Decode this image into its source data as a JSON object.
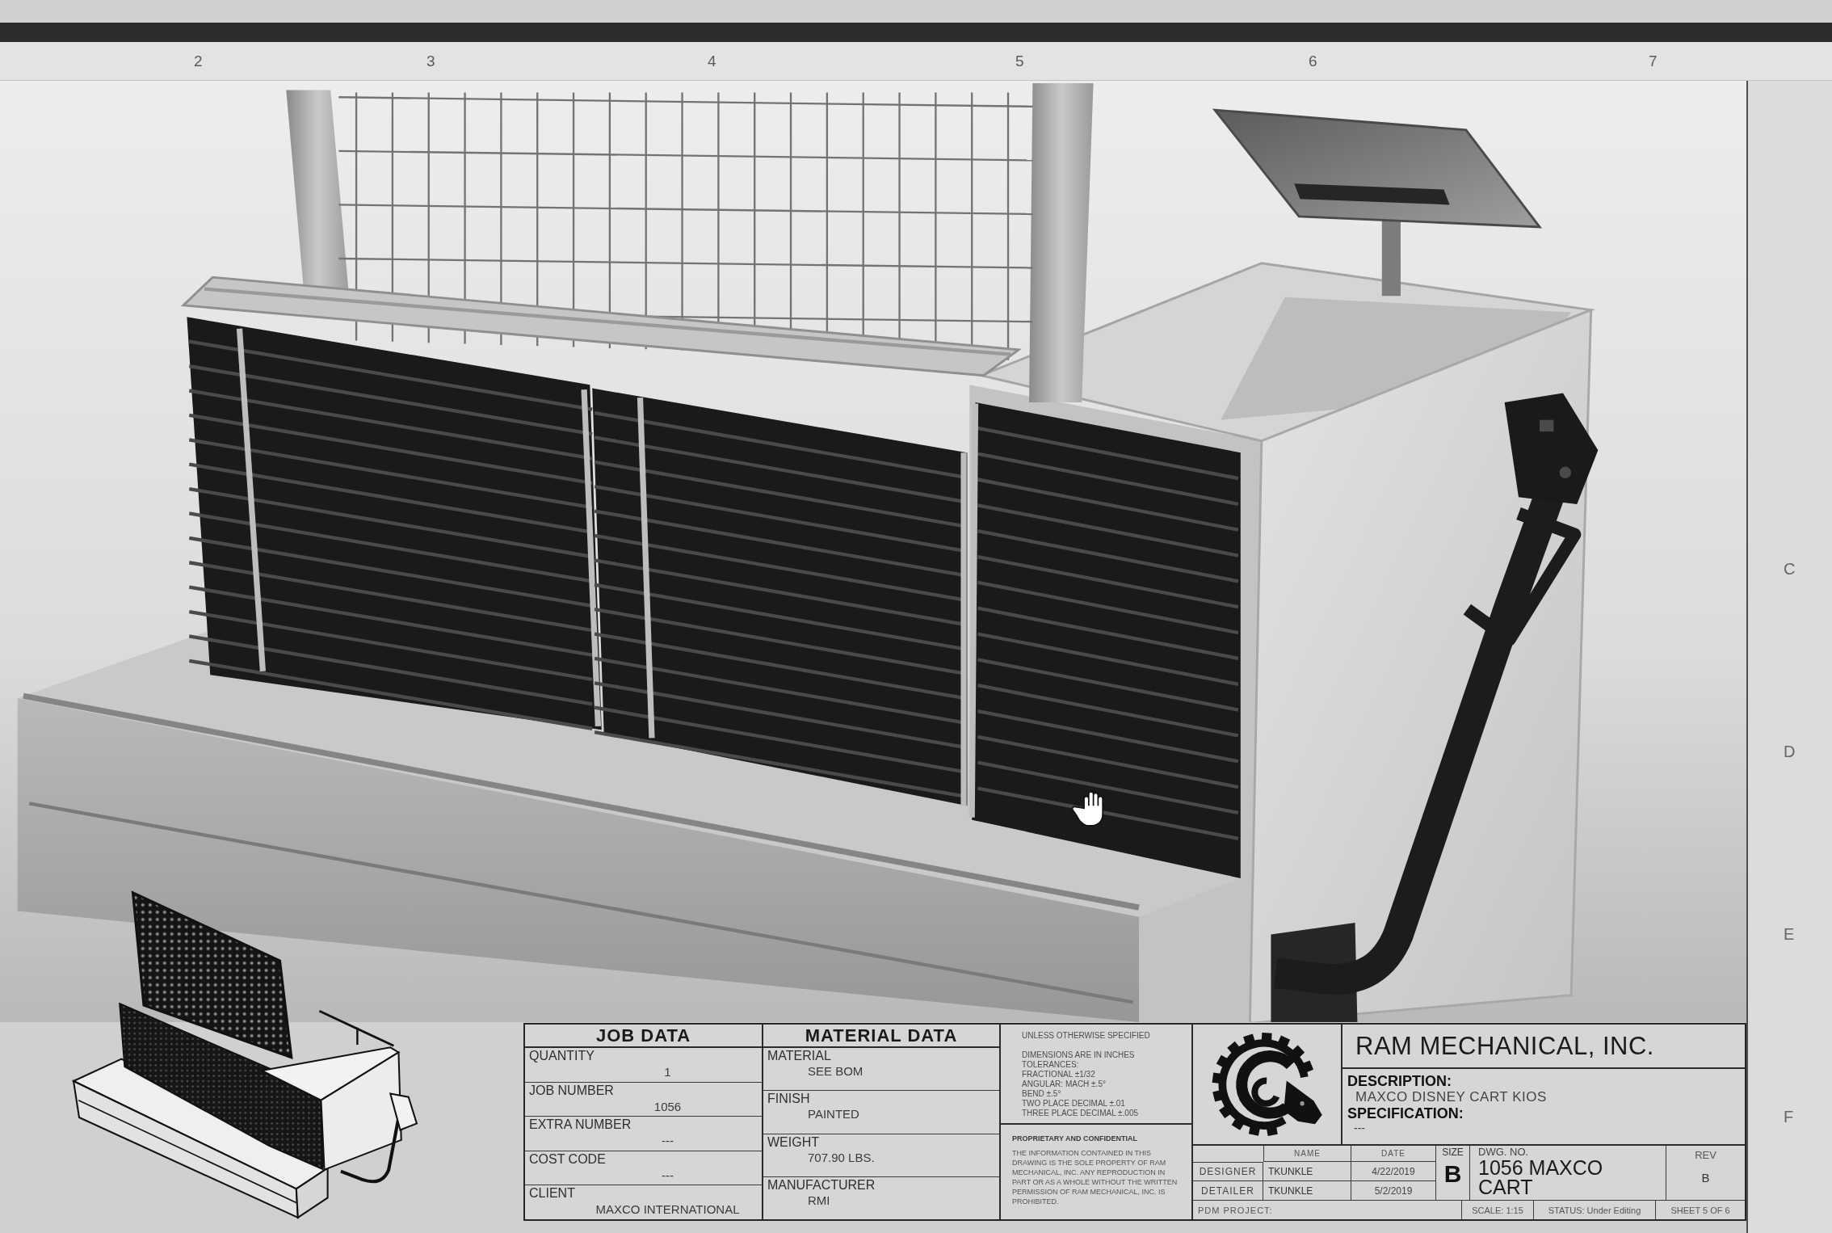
{
  "sheet": {
    "column_markers": [
      "2",
      "3",
      "4",
      "5",
      "6",
      "7"
    ],
    "row_markers": [
      "C",
      "D",
      "E",
      "F"
    ]
  },
  "title_block": {
    "job_data": {
      "title": "JOB DATA",
      "fields": [
        {
          "label": "QUANTITY",
          "value": "1"
        },
        {
          "label": "JOB NUMBER",
          "value": "1056"
        },
        {
          "label": "EXTRA NUMBER",
          "value": "---"
        },
        {
          "label": "COST CODE",
          "value": "---"
        },
        {
          "label": "CLIENT",
          "value": "MAXCO INTERNATIONAL"
        }
      ]
    },
    "material_data": {
      "title": "MATERIAL DATA",
      "fields": [
        {
          "label": "MATERIAL",
          "value": "SEE BOM"
        },
        {
          "label": "FINISH",
          "value": "PAINTED"
        },
        {
          "label": "WEIGHT",
          "value": "707.90 LBS."
        },
        {
          "label": "MANUFACTURER",
          "value": "RMI"
        }
      ]
    },
    "tolerances": {
      "heading": "UNLESS OTHERWISE SPECIFIED",
      "lines": [
        "DIMENSIONS ARE IN INCHES",
        "TOLERANCES:",
        "FRACTIONAL ±1/32",
        "ANGULAR: MACH ±.5°",
        "BEND ±.5°",
        "TWO PLACE DECIMAL ±.01",
        "THREE PLACE DECIMAL ±.005"
      ]
    },
    "notice": {
      "heading": "PROPRIETARY AND CONFIDENTIAL",
      "text": "THE INFORMATION CONTAINED IN THIS DRAWING IS THE SOLE PROPERTY OF RAM MECHANICAL, INC. ANY REPRODUCTION IN PART OR AS A WHOLE WITHOUT THE WRITTEN PERMISSION OF RAM MECHANICAL, INC. IS PROHIBITED."
    },
    "company": "RAM MECHANICAL, INC.",
    "description": {
      "label": "DESCRIPTION:",
      "value": "MAXCO DISNEY CART KIOS"
    },
    "specification": {
      "label": "SPECIFICATION:",
      "value": "---"
    },
    "approvals": {
      "columns": [
        "NAME",
        "DATE"
      ],
      "rows": [
        {
          "role": "DESIGNER",
          "name": "TKUNKLE",
          "date": "4/22/2019"
        },
        {
          "role": "DETAILER",
          "name": "TKUNKLE",
          "date": "5/2/2019"
        }
      ]
    },
    "size": {
      "label": "SIZE",
      "value": "B"
    },
    "drawing_number": {
      "label": "DWG. NO.",
      "value": "1056 MAXCO CART"
    },
    "revision": {
      "label": "REV",
      "value": "B"
    },
    "pdm_project": "PDM PROJECT:",
    "scale": "SCALE: 1:15",
    "status": "STATUS: Under Editing",
    "sheet": "SHEET 5 OF 6"
  }
}
